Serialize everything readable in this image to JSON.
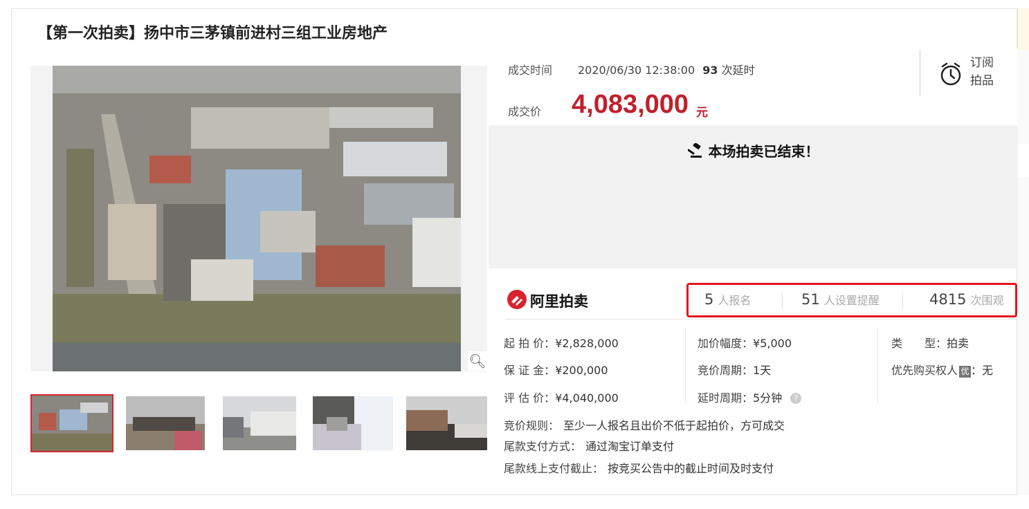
{
  "title": "【第一次拍卖】扬中市三茅镇前进村三组工业房地产",
  "deal": {
    "time_label": "成交时间",
    "time_value": "2020/06/30 12:38:00",
    "delay_count": "93",
    "delay_label": "次延时",
    "price_label": "成交价",
    "price_value": "4,083,000",
    "price_unit": "元"
  },
  "subscribe": {
    "line1": "订阅",
    "line2": "拍品",
    "icon": "alarm-clock-icon"
  },
  "ended_text": "本场拍卖已结束！",
  "brand": {
    "name": "阿里拍卖",
    "icon": "ali-auction-logo"
  },
  "stats": [
    {
      "num": "5",
      "unit": "人报名"
    },
    {
      "num": "51",
      "unit": "人设置提醒"
    },
    {
      "num": "4815",
      "unit": "次围观"
    }
  ],
  "details": {
    "start_price": {
      "label": "起 拍 价：",
      "value": "¥2,828,000"
    },
    "deposit": {
      "label": "保 证 金：",
      "value": "¥200,000"
    },
    "appraisal": {
      "label": "评 估 价：",
      "value": "¥4,040,000"
    },
    "increment": {
      "label": "加价幅度：",
      "value": "¥5,000"
    },
    "bid_cycle": {
      "label": "竞价周期：",
      "value": "1天"
    },
    "delay_cycle": {
      "label": "延时周期：",
      "value": "5分钟"
    },
    "type": {
      "label": "类　　型：",
      "value": "拍卖"
    },
    "priority": {
      "label": "优先购买权人",
      "badge": "优",
      "value": "：无"
    }
  },
  "rules": [
    {
      "label": "竞价规则：",
      "value": "至少一人报名且出价不低于起拍价，方可成交"
    },
    {
      "label": "尾款支付方式：",
      "value": "通过淘宝订单支付"
    },
    {
      "label": "尾款线上支付截止：",
      "value": "按竞买公告中的截止时间及时支付"
    }
  ],
  "colors": {
    "accent": "#c0202b",
    "highlight_box": "#e3141c"
  }
}
